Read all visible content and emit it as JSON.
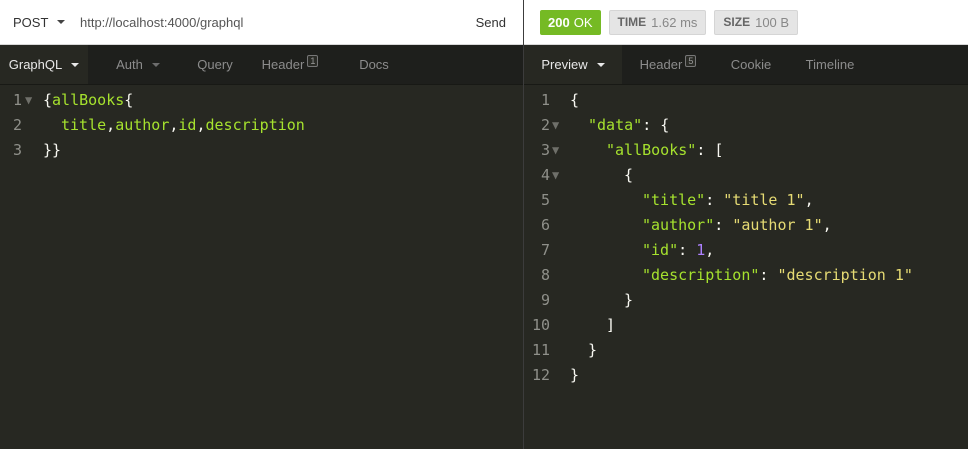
{
  "request": {
    "method": "POST",
    "url": "http://localhost:4000/graphql",
    "send_label": "Send",
    "tabs": [
      {
        "label": "GraphQL",
        "active": true,
        "dropdown": true
      },
      {
        "label": "Auth",
        "active": false,
        "dropdown": true
      },
      {
        "label": "Query",
        "active": false
      },
      {
        "label": "Header",
        "active": false,
        "badge": "1"
      },
      {
        "label": "Docs",
        "active": false
      }
    ],
    "body": {
      "line_numbers": [
        "1",
        "2",
        "3"
      ],
      "line1": {
        "open": "{",
        "field": "allBooks",
        "brace": "{"
      },
      "line2": {
        "f1": "title",
        "c1": ",",
        "f2": "author",
        "c2": ",",
        "f3": "id",
        "c3": ",",
        "f4": "description"
      },
      "line3": {
        "close": "}}"
      }
    }
  },
  "response": {
    "status": {
      "code": "200",
      "text": "OK"
    },
    "time": {
      "label": "TIME",
      "value": "1.62 ms"
    },
    "size": {
      "label": "SIZE",
      "value": "100 B"
    },
    "tabs": [
      {
        "label": "Preview",
        "active": true,
        "dropdown": true
      },
      {
        "label": "Header",
        "active": false,
        "badge": "5"
      },
      {
        "label": "Cookie",
        "active": false
      },
      {
        "label": "Timeline",
        "active": false
      }
    ],
    "body": {
      "line_numbers": [
        "1",
        "2",
        "3",
        "4",
        "5",
        "6",
        "7",
        "8",
        "9",
        "10",
        "11",
        "12"
      ],
      "l1": "{",
      "l2_key": "\"data\"",
      "l2_rest": ": {",
      "l3_key": "\"allBooks\"",
      "l3_rest": ": [",
      "l4": "{",
      "l5_key": "\"title\"",
      "l5_sep": ": ",
      "l5_val": "\"title 1\"",
      "l5_end": ",",
      "l6_key": "\"author\"",
      "l6_sep": ": ",
      "l6_val": "\"author 1\"",
      "l6_end": ",",
      "l7_key": "\"id\"",
      "l7_sep": ": ",
      "l7_val": "1",
      "l7_end": ",",
      "l8_key": "\"description\"",
      "l8_sep": ": ",
      "l8_val": "\"description 1\"",
      "l9": "}",
      "l10": "]",
      "l11": "}",
      "l12": "}"
    }
  },
  "colors": {
    "editor_bg": "#272822",
    "key_green": "#a6e22e",
    "string_yellow": "#e6db74",
    "number_purple": "#ae81ff",
    "status_ok_green": "#75ba24"
  }
}
